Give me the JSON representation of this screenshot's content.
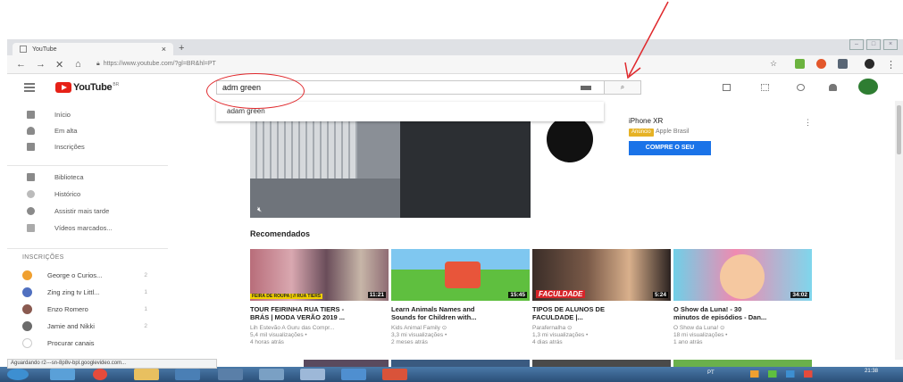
{
  "browser": {
    "tab_title": "YouTube",
    "tab_close": "×",
    "new_tab": "+",
    "url": "https://www.youtube.com/?gl=BR&hl=PT"
  },
  "youtube": {
    "logo_text": "YouTube",
    "logo_sup": "BR",
    "search_value": "adm green",
    "search_suggestion": "adam green",
    "search_button": "⌕"
  },
  "sidebar": {
    "items": [
      {
        "label": "Início"
      },
      {
        "label": "Em alta"
      },
      {
        "label": "Inscrições"
      },
      {
        "label": "Biblioteca"
      },
      {
        "label": "Histórico"
      },
      {
        "label": "Assistir mais tarde"
      },
      {
        "label": "Vídeos marcados..."
      }
    ],
    "subscriptions_header": "INSCRIÇÕES",
    "subscriptions": [
      {
        "label": "George o Curios...",
        "count": "2"
      },
      {
        "label": "Zing zing tv Littl...",
        "count": "1"
      },
      {
        "label": "Enzo Romero",
        "count": "1"
      },
      {
        "label": "Jamie and Nikki",
        "count": "2"
      },
      {
        "label": "Procurar canais",
        "count": ""
      }
    ]
  },
  "ad": {
    "title": "iPhone XR",
    "badge": "Anúncio",
    "advertiser": "Apple Brasil",
    "cta": "COMPRE O SEU",
    "more": "⋮"
  },
  "recommended": {
    "title": "Recomendados",
    "videos": [
      {
        "title1": "TOUR FEIRINHA RUA TIERS -",
        "title2": "BRÁS | MODA VERÃO 2019 ...",
        "channel": "Lih Estevão A Guru das Compr...",
        "views": "5,4 mil visualizações •",
        "age": "4 horas atrás",
        "duration": "11:21",
        "overlay": "FEIRA DE ROUPA | // RUA TIERS"
      },
      {
        "title1": "Learn Animals Names and",
        "title2": "Sounds for Children with...",
        "channel": "Kids Animal Family ⊙",
        "views": "3,3 mi visualizações •",
        "age": "2 meses atrás",
        "duration": "15:45",
        "overlay": ""
      },
      {
        "title1": "TIPOS DE ALUNOS DE",
        "title2": "FACULDADE |...",
        "channel": "Parafernalha ⊙",
        "views": "1,3 mi visualizações •",
        "age": "4 dias atrás",
        "duration": "5:24",
        "overlay": "FACULDADE"
      },
      {
        "title1": "O Show da Luna! - 30",
        "title2": "minutos de episódios - Dan...",
        "channel": "O Show da Luna! ⊙",
        "views": "18 mi visualizações •",
        "age": "1 ano atrás",
        "duration": "34:02",
        "overlay": ""
      }
    ]
  },
  "status_bar": "Aguardando r2---sn-8p8v-bpl.googlevideo.com...",
  "taskbar": {
    "lang": "PT",
    "time": "21:38"
  },
  "colors": {
    "annotation": "#e0282c",
    "youtube_red": "#e62117",
    "cta_blue": "#1a73e8",
    "ad_badge": "#e6b225"
  }
}
